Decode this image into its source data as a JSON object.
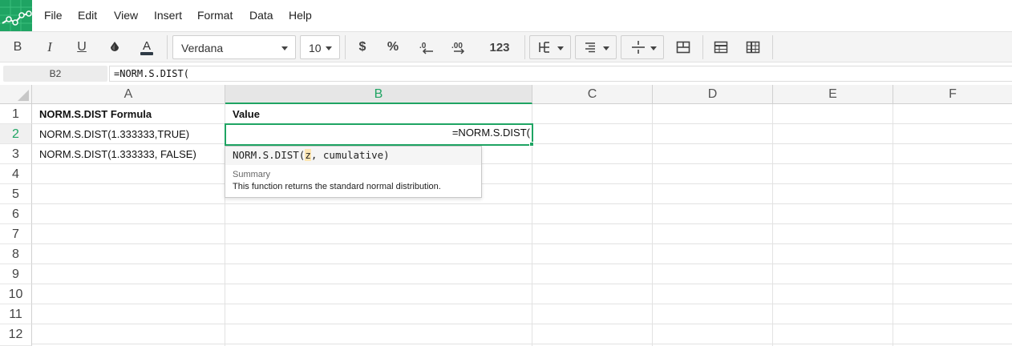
{
  "menu": {
    "items": [
      "File",
      "Edit",
      "View",
      "Insert",
      "Format",
      "Data",
      "Help"
    ]
  },
  "toolbar": {
    "bold": "B",
    "italic": "I",
    "underline": "U",
    "font_name": "Verdana",
    "font_size": "10",
    "currency": "$",
    "percent": "%",
    "number_format": "123",
    "icons": [
      "bold-icon",
      "italic-icon",
      "underline-icon",
      "fill-color-icon",
      "text-color-icon",
      "currency-icon",
      "percent-icon",
      "decrease-decimals-icon",
      "increase-decimals-icon",
      "borders-icon",
      "horizontal-align-icon",
      "vertical-align-icon",
      "merge-cells-icon",
      "freeze-rows-icon",
      "freeze-columns-icon"
    ]
  },
  "formula_bar": {
    "cell_ref": "B2",
    "value": "=NORM.S.DIST("
  },
  "grid": {
    "columns": [
      "A",
      "B",
      "C",
      "D",
      "E",
      "F"
    ],
    "rows": [
      "1",
      "2",
      "3",
      "4",
      "5",
      "6",
      "7",
      "8",
      "9",
      "10",
      "11",
      "12"
    ],
    "active_column": "B",
    "active_row": "2",
    "cells": {
      "A1": "NORM.S.DIST Formula",
      "B1": "Value",
      "A2": "NORM.S.DIST(1.333333,TRUE)",
      "A3": "NORM.S.DIST(1.333333, FALSE)"
    },
    "editor_value": "=NORM.S.DIST("
  },
  "autocomplete": {
    "func_name": "NORM.S.DIST(",
    "arg_active": "z",
    "args_rest": ", cumulative)",
    "summary_title": "Summary",
    "summary_text": "This function returns the standard normal distribution."
  },
  "colors": {
    "accent": "#1fa463",
    "toolbar_bg": "#f4f4f4",
    "arg_highlight": "#fde6b3"
  }
}
